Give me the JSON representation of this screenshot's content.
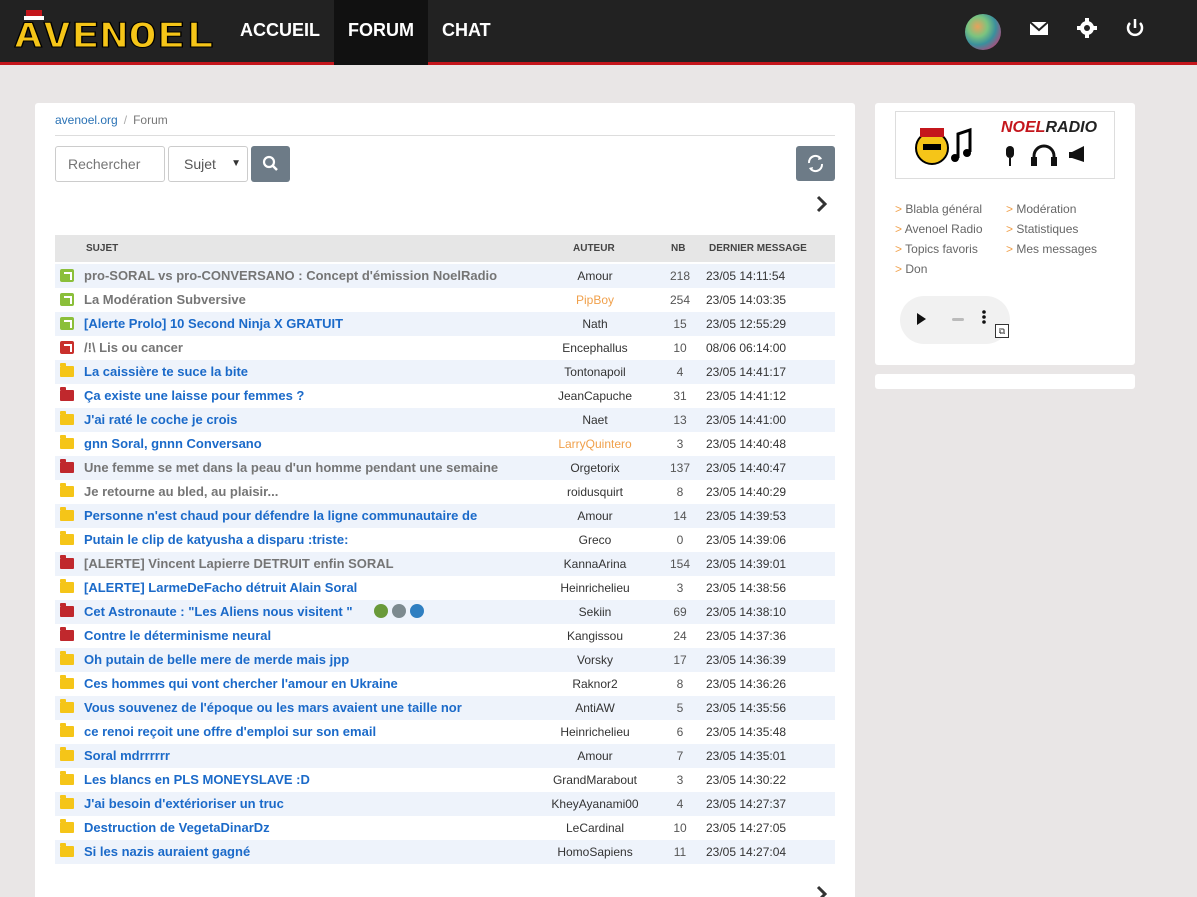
{
  "header": {
    "logo_text": "AVENOEL",
    "nav": [
      {
        "label": "ACCUEIL",
        "active": false
      },
      {
        "label": "FORUM",
        "active": true
      },
      {
        "label": "CHAT",
        "active": false
      }
    ],
    "icons": [
      "avatar",
      "envelope-icon",
      "gear-icon",
      "power-icon"
    ]
  },
  "breadcrumb": {
    "home": "avenoel.org",
    "current": "Forum"
  },
  "search": {
    "placeholder": "Rechercher",
    "select_value": "Sujet"
  },
  "table": {
    "columns": [
      "SUJET",
      "AUTEUR",
      "NB",
      "DERNIER MESSAGE"
    ],
    "rows": [
      {
        "icon": "pin-green",
        "title": "pro-SORAL vs pro-CONVERSANO : Concept d'émission NoelRadio",
        "style": "gray",
        "author": "Amour",
        "author_style": "",
        "nb": "218",
        "date": "23/05 14:11:54"
      },
      {
        "icon": "pin-green",
        "title": "La Modération Subversive",
        "style": "gray",
        "author": "PipBoy",
        "author_style": "orange",
        "nb": "254",
        "date": "23/05 14:03:35"
      },
      {
        "icon": "pin-green",
        "title": "[Alerte Prolo] 10 Second Ninja X GRATUIT",
        "style": "blue",
        "author": "Nath",
        "author_style": "",
        "nb": "15",
        "date": "23/05 12:55:29"
      },
      {
        "icon": "pin-red",
        "title": "/!\\ Lis ou cancer",
        "style": "gray",
        "author": "Encephallus",
        "author_style": "",
        "nb": "10",
        "date": "08/06 06:14:00"
      },
      {
        "icon": "folder-yellow",
        "title": "La caissière te suce la bite",
        "style": "blue",
        "author": "Tontonapoil",
        "author_style": "",
        "nb": "4",
        "date": "23/05 14:41:17"
      },
      {
        "icon": "folder-red",
        "title": "Ça existe une laisse pour femmes ?",
        "style": "blue",
        "author": "JeanCapuche",
        "author_style": "",
        "nb": "31",
        "date": "23/05 14:41:12"
      },
      {
        "icon": "folder-yellow",
        "title": "J'ai raté le coche je crois",
        "style": "blue",
        "author": "Naet",
        "author_style": "",
        "nb": "13",
        "date": "23/05 14:41:00"
      },
      {
        "icon": "folder-yellow",
        "title": "gnn Soral, gnnn Conversano",
        "style": "blue",
        "author": "LarryQuintero",
        "author_style": "orange",
        "nb": "3",
        "date": "23/05 14:40:48"
      },
      {
        "icon": "folder-red",
        "title": "Une femme se met dans la peau d'un homme pendant une semaine",
        "style": "gray",
        "author": "Orgetorix",
        "author_style": "",
        "nb": "137",
        "date": "23/05 14:40:47"
      },
      {
        "icon": "folder-yellow",
        "title": "Je retourne au bled, au plaisir...",
        "style": "gray",
        "author": "roidusquirt",
        "author_style": "",
        "nb": "8",
        "date": "23/05 14:40:29"
      },
      {
        "icon": "folder-yellow",
        "title": "Personne n'est chaud pour défendre la ligne communautaire de",
        "style": "blue",
        "author": "Amour",
        "author_style": "",
        "nb": "14",
        "date": "23/05 14:39:53"
      },
      {
        "icon": "folder-yellow",
        "title": "Putain le clip de katyusha a disparu :triste:",
        "style": "blue",
        "author": "Greco",
        "author_style": "",
        "nb": "0",
        "date": "23/05 14:39:06"
      },
      {
        "icon": "folder-red",
        "title": "[ALERTE] Vincent Lapierre DETRUIT enfin SORAL",
        "style": "gray",
        "author": "KannaArina",
        "author_style": "",
        "nb": "154",
        "date": "23/05 14:39:01"
      },
      {
        "icon": "folder-yellow",
        "title": "[ALERTE] LarmeDeFacho détruit Alain Soral",
        "style": "blue",
        "author": "Heinrichelieu",
        "author_style": "",
        "nb": "3",
        "date": "23/05 14:38:56"
      },
      {
        "icon": "folder-red",
        "title": "Cet Astronaute : \"Les Aliens nous visitent \"",
        "style": "blue",
        "author": "Sekiin",
        "author_style": "",
        "nb": "69",
        "date": "23/05 14:38:10",
        "emojis": [
          "#6a9a3a",
          "#7d8a8f",
          "#2f7fc1"
        ]
      },
      {
        "icon": "folder-red",
        "title": "Contre le déterminisme neural",
        "style": "blue",
        "author": "Kangissou",
        "author_style": "",
        "nb": "24",
        "date": "23/05 14:37:36"
      },
      {
        "icon": "folder-yellow",
        "title": "Oh putain de belle mere de merde mais jpp",
        "style": "blue",
        "author": "Vorsky",
        "author_style": "",
        "nb": "17",
        "date": "23/05 14:36:39"
      },
      {
        "icon": "folder-yellow",
        "title": "Ces hommes qui vont chercher l'amour en Ukraine",
        "style": "blue",
        "author": "Raknor2",
        "author_style": "",
        "nb": "8",
        "date": "23/05 14:36:26"
      },
      {
        "icon": "folder-yellow",
        "title": "Vous souvenez de l'époque ou les mars avaient une taille nor",
        "style": "blue",
        "author": "AntiAW",
        "author_style": "",
        "nb": "5",
        "date": "23/05 14:35:56"
      },
      {
        "icon": "folder-yellow",
        "title": "ce renoi reçoit une offre d'emploi sur son email",
        "style": "blue",
        "author": "Heinrichelieu",
        "author_style": "",
        "nb": "6",
        "date": "23/05 14:35:48"
      },
      {
        "icon": "folder-yellow",
        "title": "Soral mdrrrrrr",
        "style": "blue",
        "author": "Amour",
        "author_style": "",
        "nb": "7",
        "date": "23/05 14:35:01"
      },
      {
        "icon": "folder-yellow",
        "title": "Les blancs en PLS MONEYSLAVE :D",
        "style": "blue",
        "author": "GrandMarabout",
        "author_style": "",
        "nb": "3",
        "date": "23/05 14:30:22"
      },
      {
        "icon": "folder-yellow",
        "title": "J'ai besoin d'extérioriser un truc",
        "style": "blue",
        "author": "KheyAyanami00",
        "author_style": "",
        "nb": "4",
        "date": "23/05 14:27:37"
      },
      {
        "icon": "folder-yellow",
        "title": "Destruction de VegetaDinarDz",
        "style": "blue",
        "author": "LeCardinal",
        "author_style": "",
        "nb": "10",
        "date": "23/05 14:27:05"
      },
      {
        "icon": "folder-yellow",
        "title": "Si les nazis auraient gagné",
        "style": "blue",
        "author": "HomoSapiens",
        "author_style": "",
        "nb": "11",
        "date": "23/05 14:27:04"
      }
    ]
  },
  "sidebar": {
    "radio_banner": {
      "title_red": "NOEL",
      "title_dark": "RADIO"
    },
    "links": [
      {
        "label": "Blabla général"
      },
      {
        "label": "Modération"
      },
      {
        "label": "Avenoel Radio"
      },
      {
        "label": "Statistiques"
      },
      {
        "label": "Topics favoris"
      },
      {
        "label": "Mes messages"
      },
      {
        "label": "Don"
      }
    ],
    "link_prefix": ">"
  },
  "colors": {
    "accent_red": "#c4161c",
    "link_blue": "#1b6ac9",
    "orange": "#f0a04b"
  }
}
